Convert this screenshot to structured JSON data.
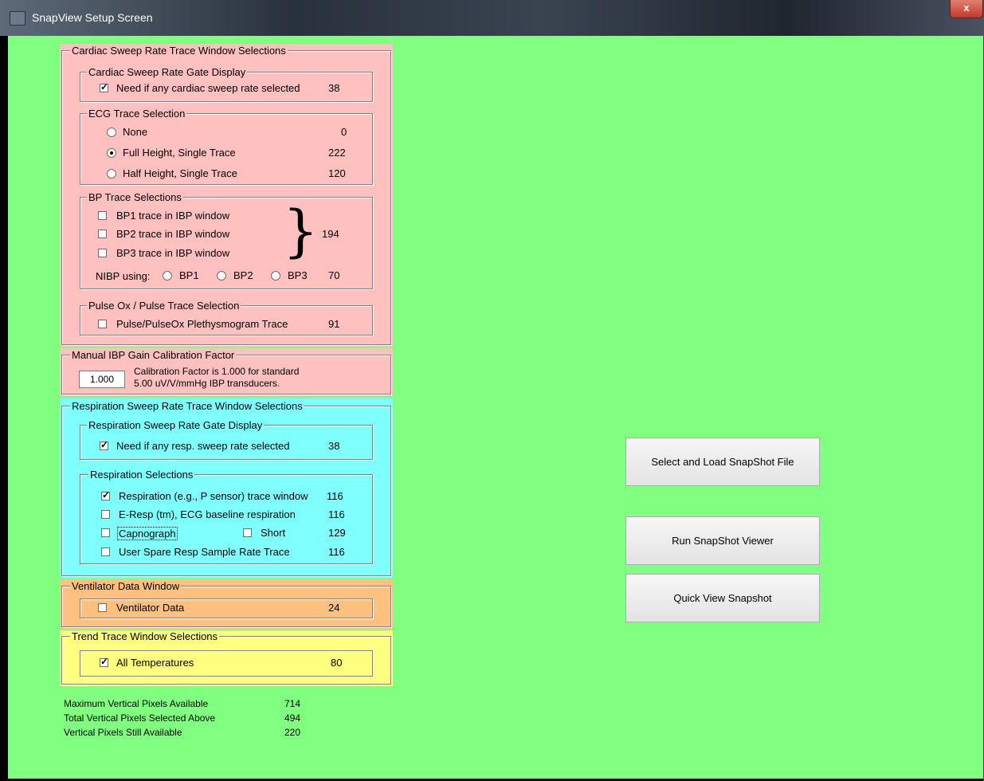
{
  "window": {
    "title": "SnapView Setup Screen",
    "close_label": "x"
  },
  "cardiac": {
    "title": "Cardiac Sweep Rate Trace Window Selections",
    "gate": {
      "title": "Cardiac Sweep Rate Gate Display",
      "label": "Need if any cardiac sweep rate selected",
      "value": "38",
      "checked": true
    },
    "ecg": {
      "title": "ECG Trace Selection",
      "options": [
        {
          "label": "None",
          "value": "0",
          "selected": false
        },
        {
          "label": "Full Height, Single Trace",
          "value": "222",
          "selected": true
        },
        {
          "label": "Half Height, Single Trace",
          "value": "120",
          "selected": false
        }
      ]
    },
    "bp": {
      "title": "BP Trace Selections",
      "traces": [
        {
          "label": "BP1 trace in IBP window",
          "checked": false
        },
        {
          "label": "BP2 trace in IBP window",
          "checked": false
        },
        {
          "label": "BP3 trace in IBP window",
          "checked": false
        }
      ],
      "brace": "}",
      "traces_value": "194",
      "nibp_label": "NIBP using:",
      "nibp_options": [
        "BP1",
        "BP2",
        "BP3"
      ],
      "nibp_value": "70"
    },
    "pulse": {
      "title": "Pulse Ox / Pulse Trace Selection",
      "label": "Pulse/PulseOx Plethysmogram Trace",
      "value": "91",
      "checked": false
    }
  },
  "calibration": {
    "title": "Manual IBP Gain Calibration Factor",
    "value": "1.000",
    "note_line1": "Calibration Factor is 1.000 for standard",
    "note_line2": "5.00 uV/V/mmHg IBP transducers."
  },
  "respiration": {
    "title": "Respiration Sweep Rate Trace Window Selections",
    "gate": {
      "title": "Respiration Sweep Rate Gate Display",
      "label": "Need if any resp. sweep rate selected",
      "value": "38",
      "checked": true
    },
    "selections": {
      "title": "Respiration Selections",
      "items": [
        {
          "label": "Respiration (e.g., P sensor) trace window",
          "value": "116",
          "checked": true
        },
        {
          "label": "E-Resp (tm), ECG baseline respiration",
          "value": "116",
          "checked": false
        },
        {
          "label": "Capnograph",
          "value": "129",
          "checked": false
        },
        {
          "label": "User Spare Resp Sample Rate Trace",
          "value": "116",
          "checked": false
        }
      ],
      "short_label": "Short"
    }
  },
  "ventilator": {
    "title": "Ventilator Data Window",
    "label": "Ventilator Data",
    "value": "24",
    "checked": false
  },
  "trend": {
    "title": "Trend Trace Window Selections",
    "label": "All Temperatures",
    "value": "80",
    "checked": true
  },
  "summary": [
    {
      "label": "Maximum Vertical Pixels Available",
      "value": "714"
    },
    {
      "label": "Total Vertical Pixels Selected Above",
      "value": "494"
    },
    {
      "label": "Vertical Pixels Still Available",
      "value": "220"
    }
  ],
  "buttons": {
    "select_load": "Select and Load SnapShot File",
    "run_viewer": "Run SnapShot Viewer",
    "quick_view": "Quick View Snapshot"
  },
  "colors": {
    "background": "#80ff80",
    "cardiac_panel": "#ffc0c0",
    "respiration_panel": "#80ffff",
    "ventilator_panel": "#ffc080",
    "trend_panel": "#ffff80"
  }
}
